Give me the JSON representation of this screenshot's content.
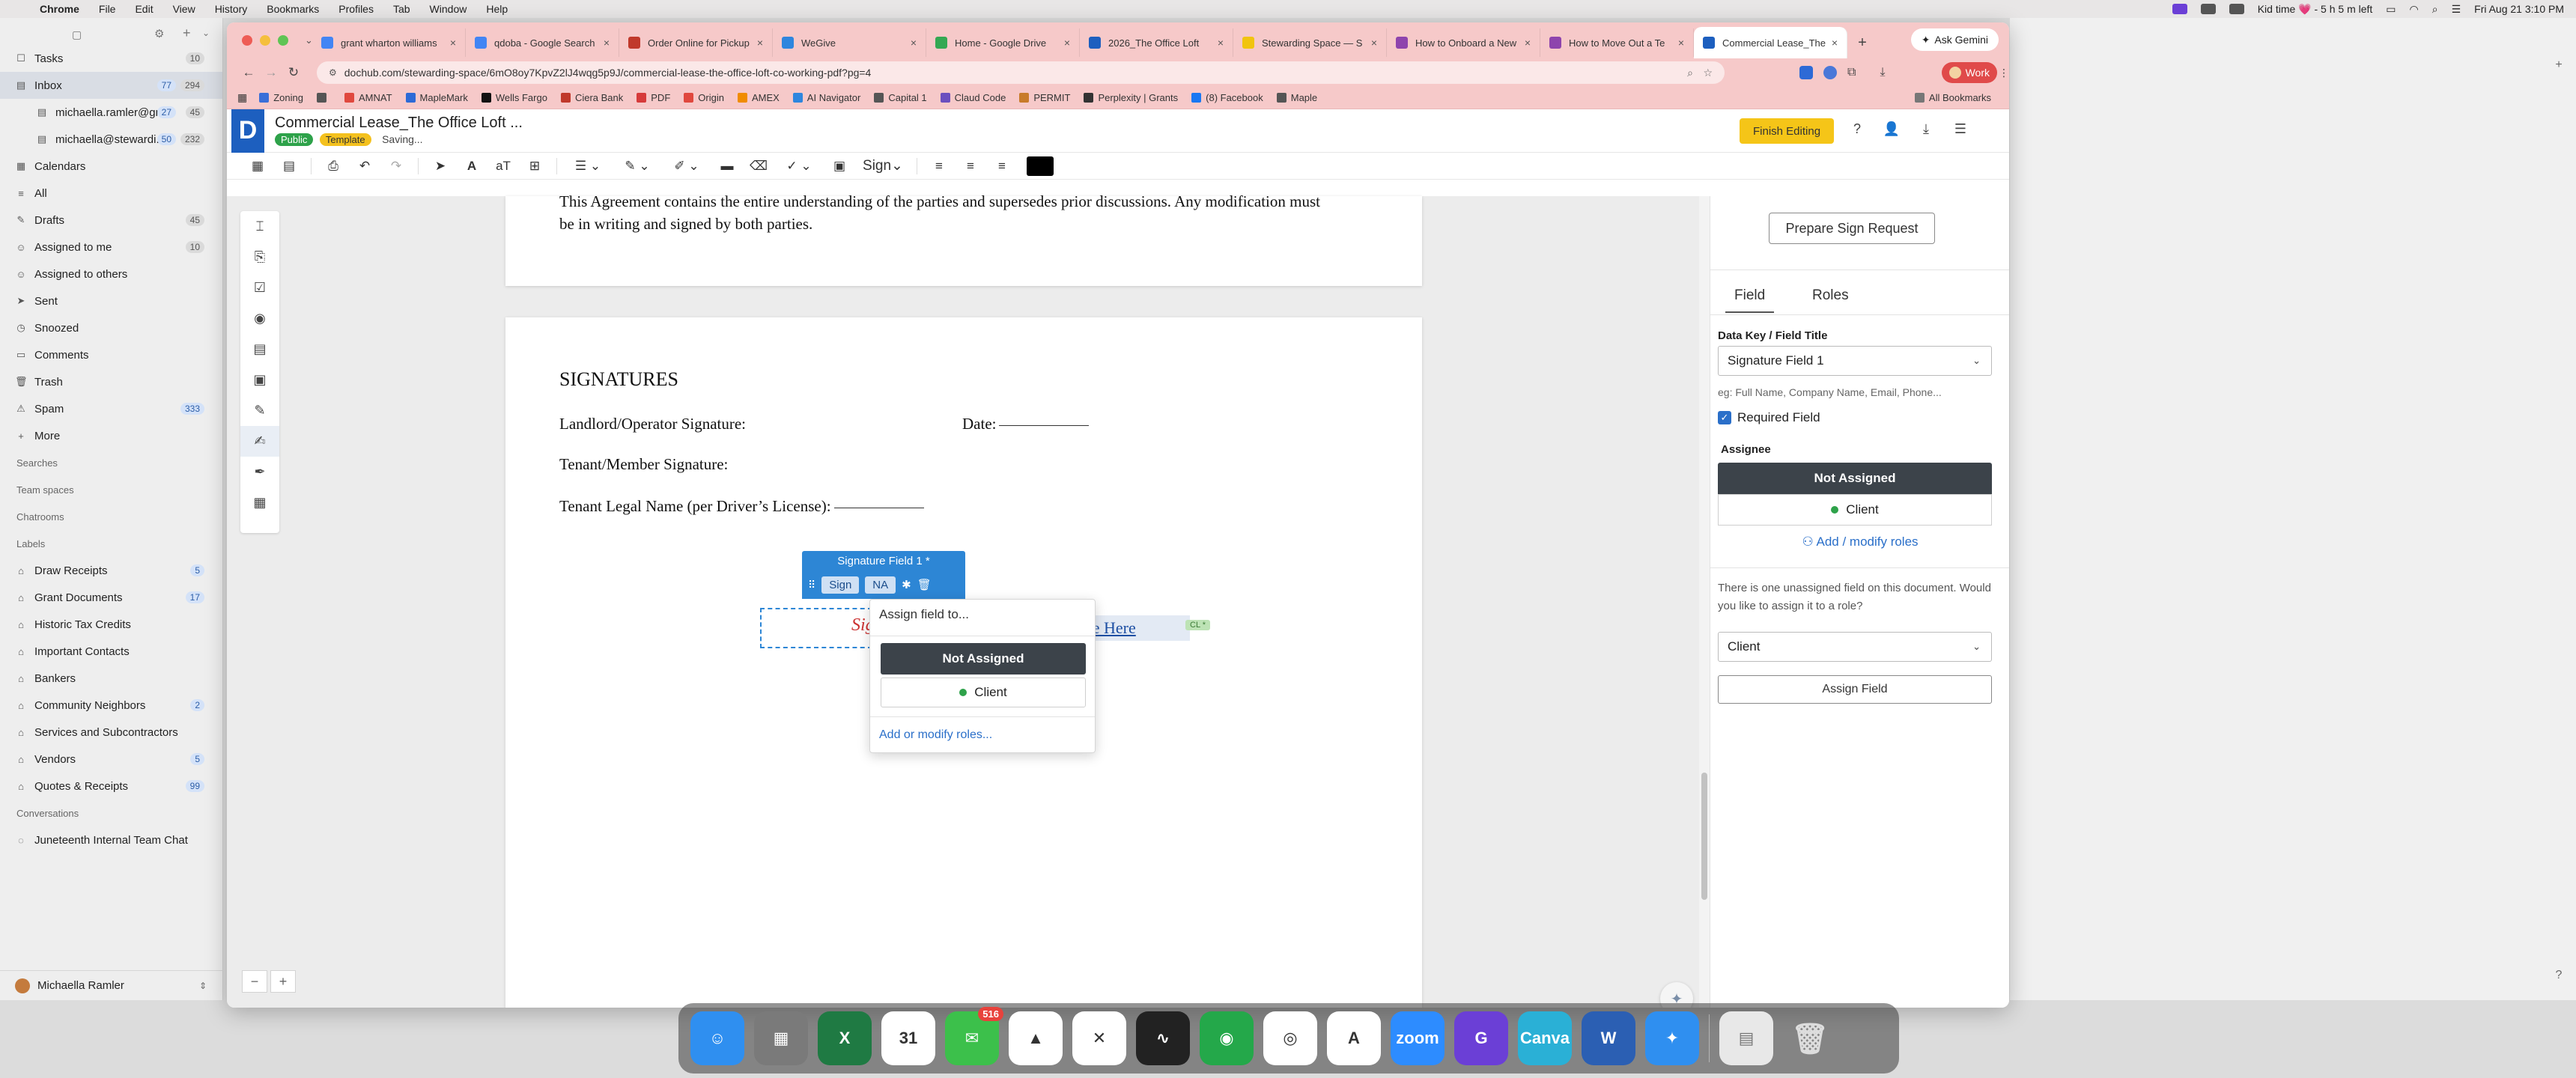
{
  "menubar": {
    "app": "Chrome",
    "menus": [
      "File",
      "Edit",
      "View",
      "History",
      "Bookmarks",
      "Profiles",
      "Tab",
      "Window",
      "Help"
    ],
    "status": "Kid time 💗 - 5 h 5 m left",
    "datetime": "Fri Aug 21 3:10 PM"
  },
  "mail": {
    "tasks": {
      "label": "Tasks",
      "count": "10"
    },
    "inbox": {
      "label": "Inbox",
      "count_a": "77",
      "count_b": "294"
    },
    "account1": {
      "label": "michaella.ramler@gm...",
      "count_a": "27",
      "count_b": "45"
    },
    "account2": {
      "label": "michaella@stewardi...",
      "count_a": "50",
      "count_b": "232"
    },
    "calendars": "Calendars",
    "all": "All",
    "drafts": {
      "label": "Drafts",
      "count": "45"
    },
    "assigned_me": {
      "label": "Assigned to me",
      "count": "10"
    },
    "assigned_others": "Assigned to others",
    "sent": "Sent",
    "snoozed": "Snoozed",
    "comments": "Comments",
    "trash": "Trash",
    "spam": {
      "label": "Spam",
      "count": "333"
    },
    "more": "More",
    "searches": "Searches",
    "team_spaces": "Team spaces",
    "chatrooms": "Chatrooms",
    "labels_head": "Labels",
    "labels": [
      {
        "label": "Draw Receipts",
        "count": "5"
      },
      {
        "label": "Grant Documents",
        "count": "17"
      },
      {
        "label": "Historic Tax Credits",
        "count": ""
      },
      {
        "label": "Important Contacts",
        "count": ""
      },
      {
        "label": "Bankers",
        "count": ""
      },
      {
        "label": "Community Neighbors",
        "count": "2"
      },
      {
        "label": "Services and Subcontractors",
        "count": ""
      },
      {
        "label": "Vendors",
        "count": "5"
      },
      {
        "label": "Quotes & Receipts",
        "count": "99"
      }
    ],
    "conversations_head": "Conversations",
    "conversation": "Juneteenth Internal Team Chat",
    "user": "Michaella Ramler"
  },
  "browser": {
    "tabs": [
      {
        "label": "grant wharton williams",
        "color": "#4285f4"
      },
      {
        "label": "qdoba - Google Search",
        "color": "#4285f4"
      },
      {
        "label": "Order Online for Pickup",
        "color": "#c0392b"
      },
      {
        "label": "WeGive",
        "color": "#2e86de"
      },
      {
        "label": "Home - Google Drive",
        "color": "#34a853"
      },
      {
        "label": "2026_The Office Loft",
        "color": "#1d5fbf"
      },
      {
        "label": "Stewarding Space — S",
        "color": "#f1c40f"
      },
      {
        "label": "How to Onboard a New",
        "color": "#8e44ad"
      },
      {
        "label": "How to Move Out a Te",
        "color": "#8e44ad"
      },
      {
        "label": "Commercial Lease_The",
        "color": "#1d5fbf"
      }
    ],
    "gemini": "Ask Gemini",
    "url": "dochub.com/stewarding-space/6mO8oy7KpvZ2lJ4wqg5p9J/commercial-lease-the-office-loft-co-working-pdf?pg=4",
    "profile": "Work",
    "bookmarks": [
      "Zoning",
      "",
      "AMNAT",
      "MapleMark",
      "Wells Fargo",
      "Ciera Bank",
      "PDF",
      "Origin",
      "AMEX",
      "AI Navigator",
      "Capital 1",
      "Claud Code",
      "PERMIT",
      "Perplexity | Grants",
      "(8) Facebook",
      "Maple"
    ],
    "all_bookmarks": "All Bookmarks"
  },
  "dochub": {
    "title": "Commercial Lease_The Office Loft ...",
    "public": "Public",
    "template": "Template",
    "saving": "Saving...",
    "finish": "Finish Editing",
    "toolbar_sign": "Sign",
    "page1_text": "This Agreement contains the entire understanding of the parties and supersedes prior discussions. Any modification must be in writing and signed by both parties.",
    "signatures_heading": "SIGNATURES",
    "landlord_line": "Landlord/Operator Signature:",
    "date_label": "Date:",
    "tenant_line": "Tenant/Member Signature:",
    "legal_name_line": "Tenant Legal Name (per Driver’s License):",
    "sig_field_title": "Signature Field 1 *",
    "chip_sign": "Sign",
    "chip_na": "NA",
    "sig_placeholder": "Sig",
    "date_field": "Date Here",
    "date_tag": "CL *",
    "popover": {
      "title": "Assign field to...",
      "not_assigned": "Not Assigned",
      "client": "Client",
      "link": "Add or modify roles..."
    },
    "panel": {
      "prepare": "Prepare Sign Request",
      "tab_field": "Field",
      "tab_roles": "Roles",
      "data_key_label": "Data Key / Field Title",
      "data_key_value": "Signature Field 1",
      "hint": "eg: Full Name, Company Name, Email, Phone...",
      "required": "Required Field",
      "assignee_label": "Assignee",
      "not_assigned": "Not Assigned",
      "client": "Client",
      "add_roles": "Add / modify roles",
      "info": "There is one unassigned field on this document. Would you like to assign it to a role?",
      "role_select": "Client",
      "assign_btn": "Assign Field"
    }
  },
  "dock": {
    "messages_badge": "516",
    "apps": [
      {
        "name": "Finder",
        "color": "#2f8ff0",
        "glyph": "☺"
      },
      {
        "name": "Launchpad",
        "color": "#7a7a7a",
        "glyph": "▦"
      },
      {
        "name": "Excel",
        "color": "#1f7a43",
        "glyph": "X"
      },
      {
        "name": "Calendar",
        "color": "#ffffff",
        "glyph": "31"
      },
      {
        "name": "Messages",
        "color": "#3cc04b",
        "glyph": "✉"
      },
      {
        "name": "ClickUp",
        "color": "#ffffff",
        "glyph": "▲"
      },
      {
        "name": "Capcut",
        "color": "#ffffff",
        "glyph": "✕"
      },
      {
        "name": "Voice Memos",
        "color": "#222222",
        "glyph": "∿"
      },
      {
        "name": "Maps",
        "color": "#24a84a",
        "glyph": "◉"
      },
      {
        "name": "Chrome",
        "color": "#ffffff",
        "glyph": "◎"
      },
      {
        "name": "Avenir",
        "color": "#ffffff",
        "glyph": "A"
      },
      {
        "name": "Zoom",
        "color": "#2d8cff",
        "glyph": "zoom"
      },
      {
        "name": "Grammarly",
        "color": "#6b3fd6",
        "glyph": "G"
      },
      {
        "name": "Canva",
        "color": "#2ab0d6",
        "glyph": "Canva"
      },
      {
        "name": "Word",
        "color": "#2b5fb3",
        "glyph": "W"
      },
      {
        "name": "Safari",
        "color": "#2f8ff0",
        "glyph": "✦"
      }
    ]
  }
}
